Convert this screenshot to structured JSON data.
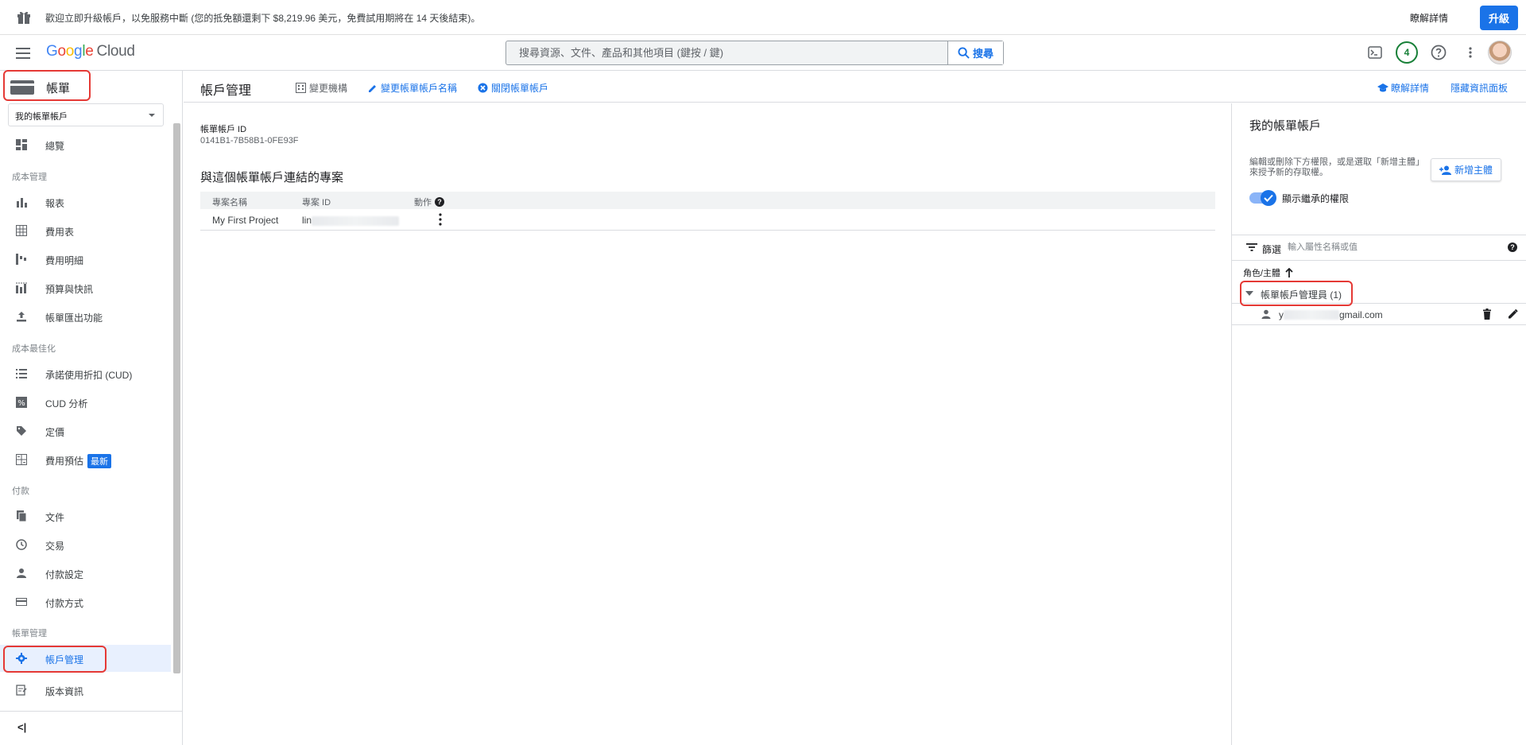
{
  "banner": {
    "text": "歡迎立即升級帳戶，以免服務中斷 (您的抵免額還剩下 $8,219.96 美元，免費試用期將在 14 天後結束)。",
    "learn_more": "瞭解詳情",
    "upgrade": "升級"
  },
  "header": {
    "logo_parts": [
      "G",
      "o",
      "o",
      "g",
      "l",
      "e"
    ],
    "logo_cloud": "Cloud",
    "search_placeholder": "搜尋資源、文件、產品和其他項目 (鍵按 / 鍵)",
    "search_button": "搜尋",
    "notification_count": "4"
  },
  "sidebar": {
    "title": "帳單",
    "account_select": "我的帳單帳戶",
    "overview": "總覽",
    "sections": {
      "cost_management": "成本管理",
      "cost_optimization": "成本最佳化",
      "payments": "付款",
      "billing_management": "帳單管理"
    },
    "items": {
      "reports": "報表",
      "cost_table": "費用表",
      "cost_breakdown": "費用明細",
      "budgets": "預算與快訊",
      "billing_export": "帳單匯出功能",
      "cud": "承諾使用折扣 (CUD)",
      "cud_analysis": "CUD 分析",
      "pricing": "定價",
      "cost_estimation": "費用預估",
      "new_badge": "最新",
      "documents": "文件",
      "transactions": "交易",
      "payment_settings": "付款設定",
      "payment_method": "付款方式",
      "account_management": "帳戶管理",
      "release_notes": "版本資訊"
    },
    "collapse": "<|"
  },
  "main": {
    "title": "帳戶管理",
    "change_org": "變更機構",
    "rename": "變更帳單帳戶名稱",
    "close_account": "關閉帳單帳戶",
    "learn_more": "瞭解詳情",
    "hide_panel": "隱藏資訊面板",
    "account_id_label": "帳單帳戶 ID",
    "account_id": "0141B1-7B58B1-0FE93F",
    "projects_title": "與這個帳單帳戶連結的專案",
    "table": {
      "headers": [
        "專案名稱",
        "專案 ID",
        "動作"
      ],
      "rows": [
        {
          "name": "My First Project",
          "id_prefix": "lin"
        }
      ]
    }
  },
  "panel": {
    "title": "我的帳單帳戶",
    "description": "編輯或刪除下方權限，或是選取「新增主體」來授予新的存取權。",
    "add_principal": "新增主體",
    "show_inherited": "顯示繼承的權限",
    "filter_label": "篩選",
    "filter_placeholder": "輸入屬性名稱或值",
    "column_header": "角色/主體",
    "role": "帳單帳戶管理員 (1)",
    "member_prefix": "y",
    "member_suffix": "gmail.com"
  },
  "colors": {
    "accent": "#1a73e8",
    "highlight": "#e53935",
    "notification": "#188038"
  }
}
